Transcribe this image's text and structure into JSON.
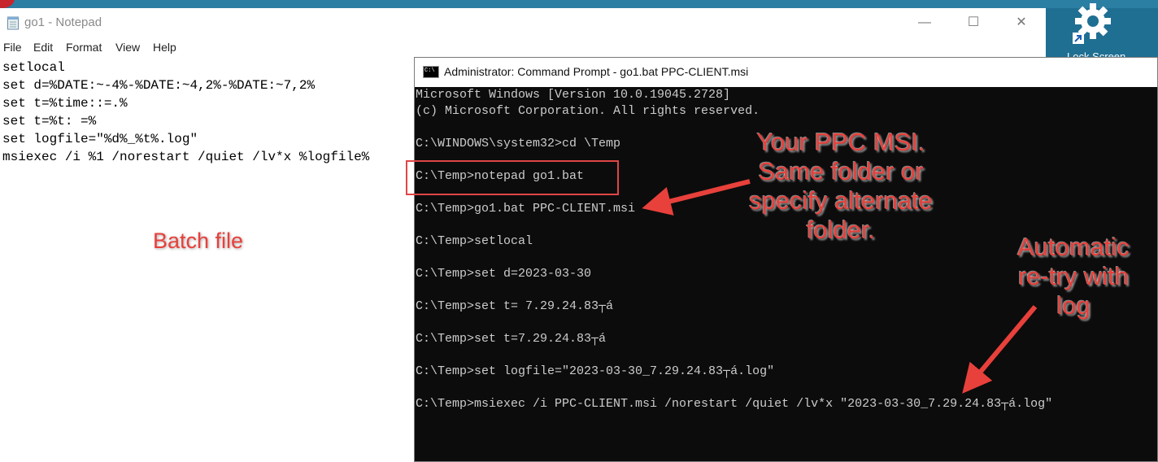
{
  "notepad": {
    "title": "go1 - Notepad",
    "menu": [
      "File",
      "Edit",
      "Format",
      "View",
      "Help"
    ],
    "content": "setlocal\nset d=%DATE:~-4%-%DATE:~4,2%-%DATE:~7,2%\nset t=%time::=.%\nset t=%t: =%\nset logfile=\"%d%_%t%.log\"\nmsiexec /i %1 /norestart /quiet /lv*x %logfile%",
    "controls": {
      "minimize": "—",
      "maximize": "☐",
      "close": "✕"
    }
  },
  "desktop": {
    "lock_screen_label": "Lock Screen",
    "lock_icon": "gear-icon"
  },
  "cmd": {
    "icon_text": "C:\\",
    "title": "Administrator: Command Prompt - go1.bat  PPC-CLIENT.msi",
    "lines": [
      "Microsoft Windows [Version 10.0.19045.2728]",
      "(c) Microsoft Corporation. All rights reserved.",
      "",
      "C:\\WINDOWS\\system32>cd \\Temp",
      "",
      "C:\\Temp>notepad go1.bat",
      "",
      "C:\\Temp>go1.bat PPC-CLIENT.msi",
      "",
      "C:\\Temp>setlocal",
      "",
      "C:\\Temp>set d=2023-03-30",
      "",
      "C:\\Temp>set t= 7.29.24.83┬á",
      "",
      "C:\\Temp>set t=7.29.24.83┬á",
      "",
      "C:\\Temp>set logfile=\"2023-03-30_7.29.24.83┬á.log\"",
      "",
      "C:\\Temp>msiexec /i PPC-CLIENT.msi /norestart /quiet /lv*x \"2023-03-30_7.29.24.83┬á.log\""
    ]
  },
  "annotations": {
    "batch": "Batch file",
    "msi": [
      "Your PPC MSI.",
      "Same folder or",
      "specify alternate",
      "folder."
    ],
    "retry": [
      "Automatic",
      "re-try with",
      "log"
    ],
    "color": "#e8403b"
  }
}
